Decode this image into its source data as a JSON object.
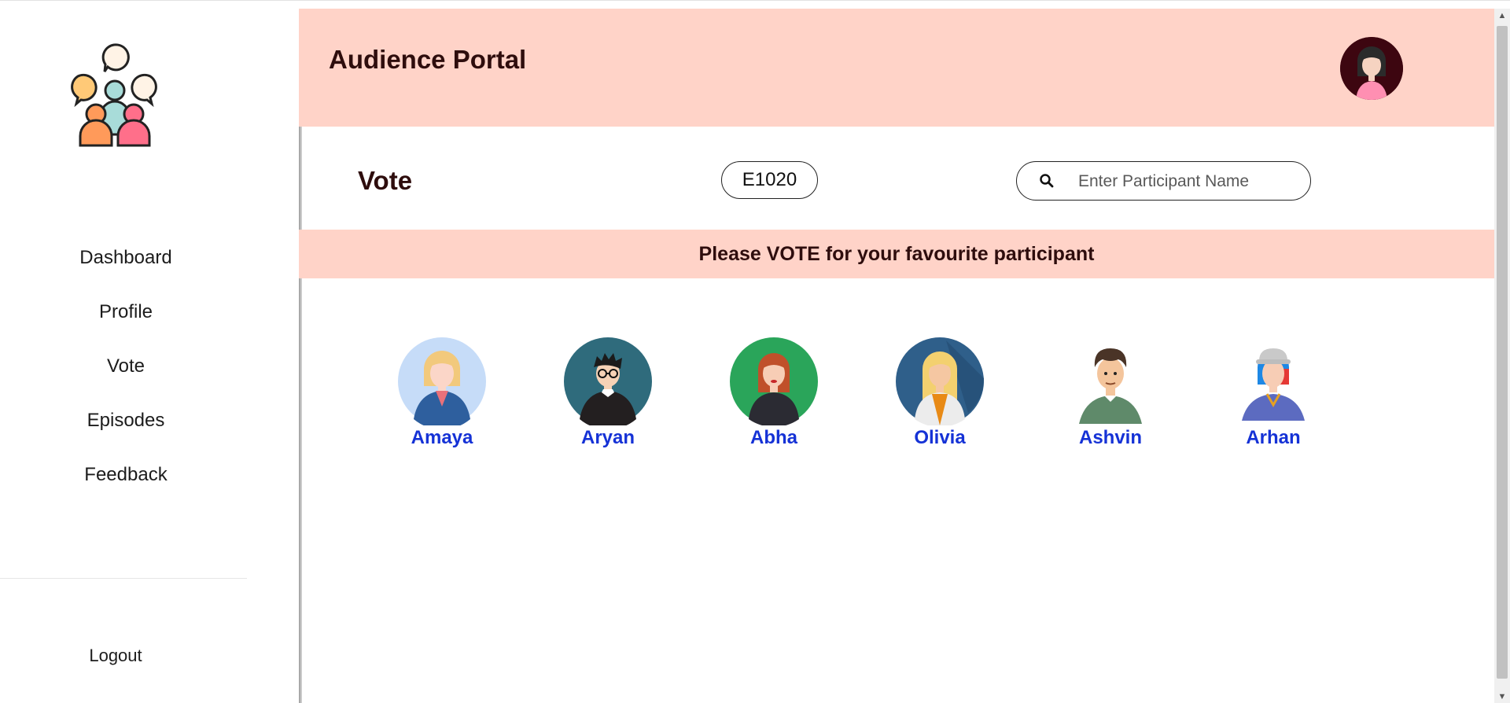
{
  "app": {
    "title": "Audience Portal"
  },
  "sidebar": {
    "items": [
      {
        "label": "Dashboard"
      },
      {
        "label": "Profile"
      },
      {
        "label": "Vote"
      },
      {
        "label": "Episodes"
      },
      {
        "label": "Feedback"
      }
    ],
    "logout_label": "Logout"
  },
  "vote": {
    "title": "Vote",
    "episode_id": "E1020",
    "search": {
      "placeholder": "Enter Participant Name",
      "value": ""
    },
    "banner": "Please VOTE for your favourite participant"
  },
  "participants": [
    {
      "name": "Amaya",
      "icon": "avatar-woman-blonde"
    },
    {
      "name": "Aryan",
      "icon": "avatar-man-glasses"
    },
    {
      "name": "Abha",
      "icon": "avatar-woman-redhead"
    },
    {
      "name": "Olivia",
      "icon": "avatar-woman-blonde-long"
    },
    {
      "name": "Ashvin",
      "icon": "avatar-man-brown-hair"
    },
    {
      "name": "Arhan",
      "icon": "avatar-man-cap"
    }
  ],
  "colors": {
    "accent": "#ffd3c8",
    "heading": "#2e0d0d",
    "participant_name": "#1532d6"
  }
}
